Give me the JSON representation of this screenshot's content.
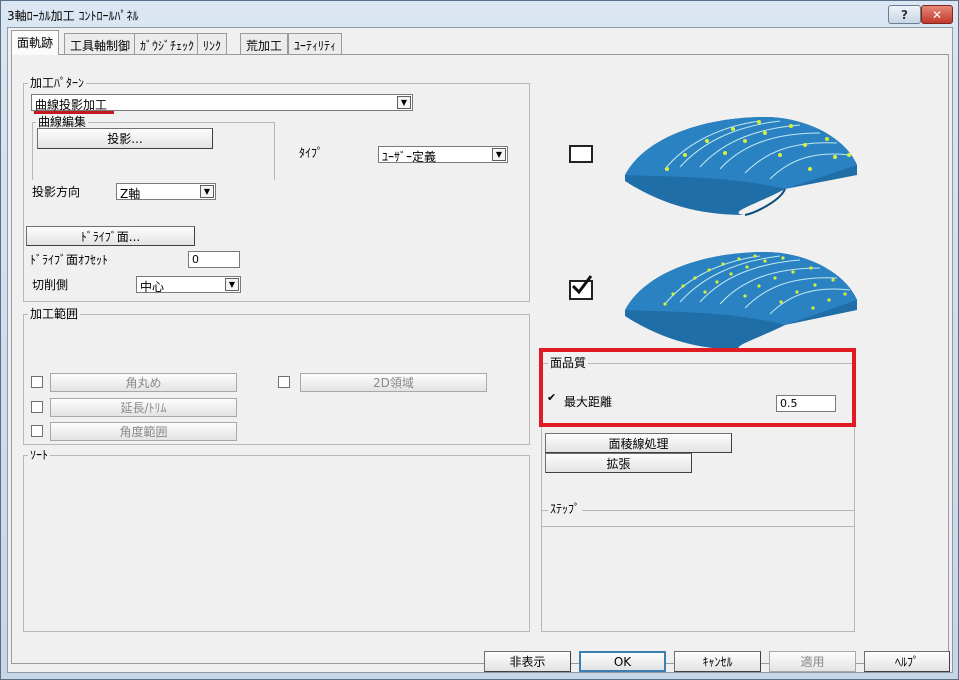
{
  "window": {
    "title": "3軸ﾛｰｶﾙ加工 ｺﾝﾄﾛｰﾙﾊﾟﾈﾙ",
    "help_icon": "?",
    "close_icon": "✕"
  },
  "tabs": [
    "面軌跡",
    "工具軸制御",
    "ｶﾞｳｼﾞﾁｪｯｸ",
    "ﾘﾝｸ",
    "荒加工",
    "ﾕｰﾃｨﾘﾃｨ"
  ],
  "pattern": {
    "group_label": "加工ﾊﾟﾀｰﾝ",
    "selected": "曲線投影加工",
    "curve_edit_label": "曲線編集",
    "project_button": "投影...",
    "type_label": "ﾀｲﾌﾟ",
    "type_value": "ﾕｰｻﾞｰ定義",
    "direction_label": "投影方向",
    "direction_value": "Z軸",
    "drive_button": "ﾄﾞﾗｲﾌﾞ面...",
    "offset_label": "ﾄﾞﾗｲﾌﾞ面ｵﾌｾｯﾄ",
    "offset_value": "0",
    "cut_side_label": "切削側",
    "cut_side_value": "中心"
  },
  "range": {
    "group_label": "加工範囲",
    "corner_button": "角丸め",
    "region_button": "2D領域",
    "extend_button": "延長/ﾄﾘﾑ",
    "angle_button": "角度範囲"
  },
  "sort": {
    "group_label": "ｿｰﾄ"
  },
  "quality": {
    "group_label": "面品質",
    "max_dist_label": "最大距離",
    "max_dist_checked": true,
    "max_dist_value": "0.5",
    "ridge_button": "面稜線処理",
    "expand_button": "拡張"
  },
  "step": {
    "group_label": "ｽﾃｯﾌﾟ"
  },
  "preview": {
    "top_checked": false,
    "bottom_checked": true
  },
  "footer": {
    "hide": "非表示",
    "ok": "OK",
    "cancel": "ｷｬﾝｾﾙ",
    "apply": "適用",
    "help": "ﾍﾙﾌﾟ"
  },
  "colors": {
    "highlight_box": "#e01b24",
    "underline": "#c4181f",
    "surface": "#1f6ea8",
    "points": "#d8f03a"
  }
}
